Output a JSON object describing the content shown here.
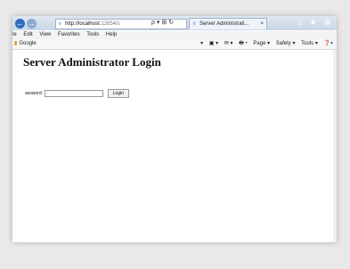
{
  "browser": {
    "address": {
      "host": "http://localhost",
      "path": ":12654/s",
      "icons": [
        "search-icon",
        "refresh-icon"
      ],
      "tools": "ρ ▾ ⊞ ↻"
    },
    "tab": {
      "title": "Server Administrati...",
      "close": "×"
    },
    "window_icons": [
      "⌂",
      "★",
      "⚙"
    ],
    "menu": [
      "le",
      "Edit",
      "View",
      "Favorites",
      "Tools",
      "Help"
    ],
    "favorites": {
      "google_label": "Google"
    },
    "command_bar": [
      "▾",
      "▣ ▾",
      "✉ ▾",
      "🖶 ▾",
      "Page ▾",
      "Safety ▾",
      "Tools ▾",
      "❓▾"
    ],
    "nav_back_glyph": "←",
    "nav_forward_glyph": "→"
  },
  "page": {
    "title": "Server Administrator Login",
    "password_label": "assword:",
    "password_value": "",
    "login_button": "Login"
  },
  "colors": {
    "accent": "#2f6fc2",
    "titlebar": "#c9d6e6"
  }
}
